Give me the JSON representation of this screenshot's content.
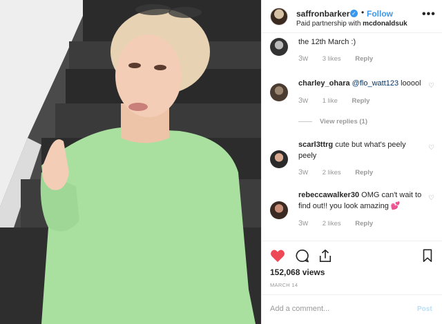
{
  "header": {
    "username": "saffronbarker",
    "verified_glyph": "✓",
    "separator": "•",
    "follow_label": "Follow",
    "partnership_prefix": "Paid partnership with",
    "partner": "mcdonaldsuk",
    "more_glyph": "•••"
  },
  "comments": [
    {
      "username": "",
      "text": "the 12th March :)",
      "time": "3w",
      "likes": "3 likes",
      "reply_label": "Reply"
    },
    {
      "username": "charley_ohara",
      "mention": "@flo_watt123",
      "text": " looool",
      "time": "3w",
      "likes": "1 like",
      "reply_label": "Reply",
      "view_replies": "View replies (1)"
    },
    {
      "username": "scarl3ttrg",
      "text": " cute but what's peely peely",
      "time": "3w",
      "likes": "2 likes",
      "reply_label": "Reply"
    },
    {
      "username": "rebeccawalker30",
      "text": " OMG can't wait to find out!! you look amazing 💕",
      "time": "3w",
      "likes": "2 likes",
      "reply_label": "Reply"
    }
  ],
  "comment_heart_glyph": "♡",
  "actions": {
    "icons": [
      "heart-filled-icon",
      "comment-icon",
      "share-icon",
      "bookmark-icon"
    ],
    "like_color": "#ed4956",
    "views": "152,068 views",
    "date": "MARCH 14"
  },
  "add_comment": {
    "placeholder": "Add a comment...",
    "post_label": "Post"
  }
}
